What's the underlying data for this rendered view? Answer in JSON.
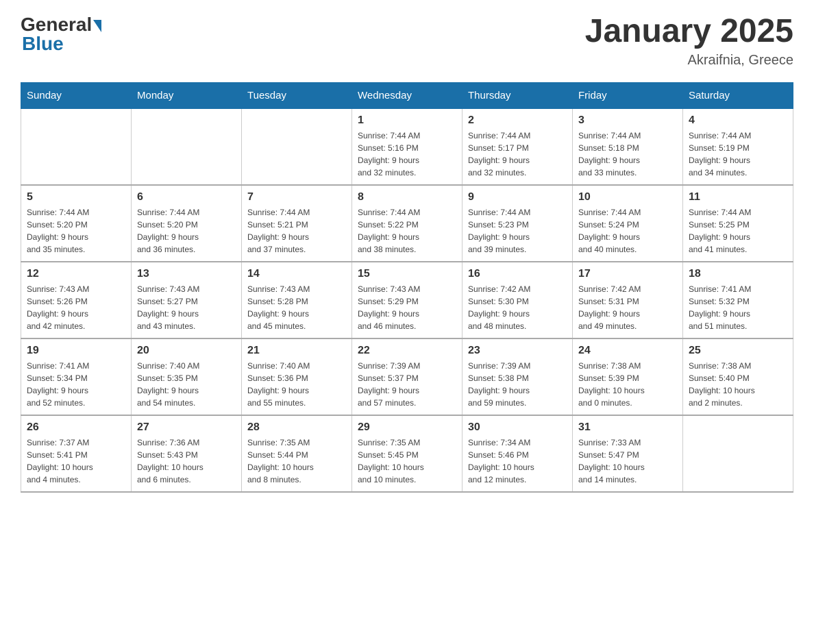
{
  "header": {
    "logo_general": "General",
    "logo_blue": "Blue",
    "title": "January 2025",
    "location": "Akraifnia, Greece"
  },
  "weekdays": [
    "Sunday",
    "Monday",
    "Tuesday",
    "Wednesday",
    "Thursday",
    "Friday",
    "Saturday"
  ],
  "weeks": [
    [
      {
        "day": "",
        "info": ""
      },
      {
        "day": "",
        "info": ""
      },
      {
        "day": "",
        "info": ""
      },
      {
        "day": "1",
        "info": "Sunrise: 7:44 AM\nSunset: 5:16 PM\nDaylight: 9 hours\nand 32 minutes."
      },
      {
        "day": "2",
        "info": "Sunrise: 7:44 AM\nSunset: 5:17 PM\nDaylight: 9 hours\nand 32 minutes."
      },
      {
        "day": "3",
        "info": "Sunrise: 7:44 AM\nSunset: 5:18 PM\nDaylight: 9 hours\nand 33 minutes."
      },
      {
        "day": "4",
        "info": "Sunrise: 7:44 AM\nSunset: 5:19 PM\nDaylight: 9 hours\nand 34 minutes."
      }
    ],
    [
      {
        "day": "5",
        "info": "Sunrise: 7:44 AM\nSunset: 5:20 PM\nDaylight: 9 hours\nand 35 minutes."
      },
      {
        "day": "6",
        "info": "Sunrise: 7:44 AM\nSunset: 5:20 PM\nDaylight: 9 hours\nand 36 minutes."
      },
      {
        "day": "7",
        "info": "Sunrise: 7:44 AM\nSunset: 5:21 PM\nDaylight: 9 hours\nand 37 minutes."
      },
      {
        "day": "8",
        "info": "Sunrise: 7:44 AM\nSunset: 5:22 PM\nDaylight: 9 hours\nand 38 minutes."
      },
      {
        "day": "9",
        "info": "Sunrise: 7:44 AM\nSunset: 5:23 PM\nDaylight: 9 hours\nand 39 minutes."
      },
      {
        "day": "10",
        "info": "Sunrise: 7:44 AM\nSunset: 5:24 PM\nDaylight: 9 hours\nand 40 minutes."
      },
      {
        "day": "11",
        "info": "Sunrise: 7:44 AM\nSunset: 5:25 PM\nDaylight: 9 hours\nand 41 minutes."
      }
    ],
    [
      {
        "day": "12",
        "info": "Sunrise: 7:43 AM\nSunset: 5:26 PM\nDaylight: 9 hours\nand 42 minutes."
      },
      {
        "day": "13",
        "info": "Sunrise: 7:43 AM\nSunset: 5:27 PM\nDaylight: 9 hours\nand 43 minutes."
      },
      {
        "day": "14",
        "info": "Sunrise: 7:43 AM\nSunset: 5:28 PM\nDaylight: 9 hours\nand 45 minutes."
      },
      {
        "day": "15",
        "info": "Sunrise: 7:43 AM\nSunset: 5:29 PM\nDaylight: 9 hours\nand 46 minutes."
      },
      {
        "day": "16",
        "info": "Sunrise: 7:42 AM\nSunset: 5:30 PM\nDaylight: 9 hours\nand 48 minutes."
      },
      {
        "day": "17",
        "info": "Sunrise: 7:42 AM\nSunset: 5:31 PM\nDaylight: 9 hours\nand 49 minutes."
      },
      {
        "day": "18",
        "info": "Sunrise: 7:41 AM\nSunset: 5:32 PM\nDaylight: 9 hours\nand 51 minutes."
      }
    ],
    [
      {
        "day": "19",
        "info": "Sunrise: 7:41 AM\nSunset: 5:34 PM\nDaylight: 9 hours\nand 52 minutes."
      },
      {
        "day": "20",
        "info": "Sunrise: 7:40 AM\nSunset: 5:35 PM\nDaylight: 9 hours\nand 54 minutes."
      },
      {
        "day": "21",
        "info": "Sunrise: 7:40 AM\nSunset: 5:36 PM\nDaylight: 9 hours\nand 55 minutes."
      },
      {
        "day": "22",
        "info": "Sunrise: 7:39 AM\nSunset: 5:37 PM\nDaylight: 9 hours\nand 57 minutes."
      },
      {
        "day": "23",
        "info": "Sunrise: 7:39 AM\nSunset: 5:38 PM\nDaylight: 9 hours\nand 59 minutes."
      },
      {
        "day": "24",
        "info": "Sunrise: 7:38 AM\nSunset: 5:39 PM\nDaylight: 10 hours\nand 0 minutes."
      },
      {
        "day": "25",
        "info": "Sunrise: 7:38 AM\nSunset: 5:40 PM\nDaylight: 10 hours\nand 2 minutes."
      }
    ],
    [
      {
        "day": "26",
        "info": "Sunrise: 7:37 AM\nSunset: 5:41 PM\nDaylight: 10 hours\nand 4 minutes."
      },
      {
        "day": "27",
        "info": "Sunrise: 7:36 AM\nSunset: 5:43 PM\nDaylight: 10 hours\nand 6 minutes."
      },
      {
        "day": "28",
        "info": "Sunrise: 7:35 AM\nSunset: 5:44 PM\nDaylight: 10 hours\nand 8 minutes."
      },
      {
        "day": "29",
        "info": "Sunrise: 7:35 AM\nSunset: 5:45 PM\nDaylight: 10 hours\nand 10 minutes."
      },
      {
        "day": "30",
        "info": "Sunrise: 7:34 AM\nSunset: 5:46 PM\nDaylight: 10 hours\nand 12 minutes."
      },
      {
        "day": "31",
        "info": "Sunrise: 7:33 AM\nSunset: 5:47 PM\nDaylight: 10 hours\nand 14 minutes."
      },
      {
        "day": "",
        "info": ""
      }
    ]
  ]
}
